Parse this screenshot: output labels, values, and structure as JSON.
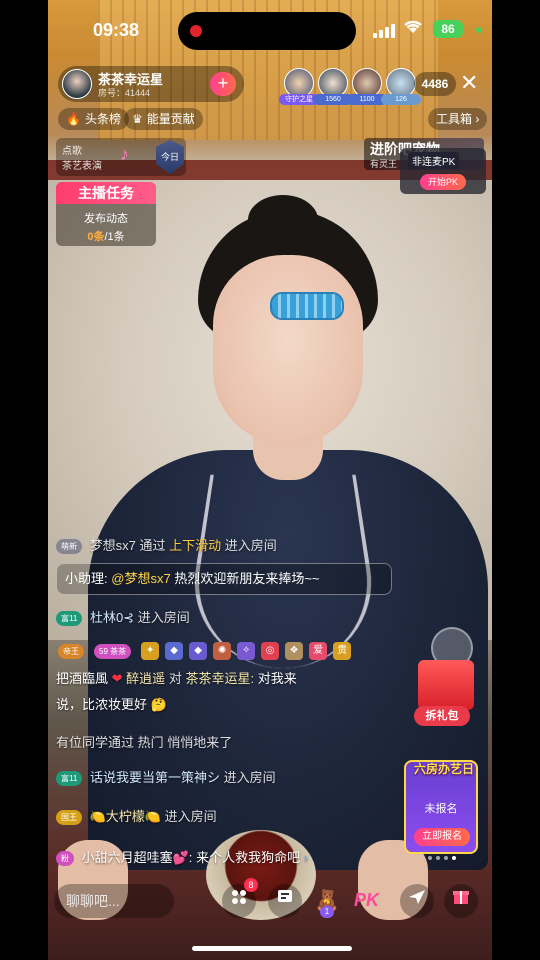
{
  "status_bar": {
    "time": "09:38",
    "battery": "86"
  },
  "host": {
    "name": "茶茶幸运星",
    "room_id": "房号：41444",
    "follow_label": "+"
  },
  "top_viewers": {
    "tags": [
      "守护之星",
      "1560",
      "1100",
      "126"
    ],
    "count": "4486"
  },
  "chips": {
    "headline": "头条榜",
    "energy": "能量贡献",
    "toolbox": "工具箱"
  },
  "song": {
    "line1": "点歌",
    "line2": "茶艺表演",
    "shield_label": "今日"
  },
  "pk": {
    "banner_title": "进阶吧宠物",
    "banner_sub": "有灵王",
    "panel_title": "非连麦PK",
    "start_label": "开始PK"
  },
  "task": {
    "title": "主播任务",
    "line1": "发布动态",
    "progress": "0条",
    "total": "/1条"
  },
  "chat": [
    {
      "badge": "萌新",
      "user": "梦想sx7",
      "text": "通过",
      "highlight": "上下滑动",
      "tail": "进入房间"
    },
    {
      "assistant": "小助理:",
      "mention": "@梦想sx7",
      "text": "热烈欢迎新朋友来捧场~~"
    },
    {
      "badge": "富11",
      "user": "杜林0⊰",
      "text": "进入房间"
    },
    {
      "line_a": "把酒臨風",
      "heart": "❤",
      "from": "醉逍遥",
      "to_word": "对",
      "to": "茶茶幸运星:",
      "msg": "对我来"
    },
    {
      "line_b": "说，比浓妆更好",
      "emoji": "🤔"
    },
    {
      "text": "有位同学通过 热门 悄悄地来了"
    },
    {
      "badge": "富11",
      "user": "话说我要当第一策神シ",
      "text": "进入房间"
    },
    {
      "badge": "国王",
      "user": "🍋大柠檬🍋",
      "text": "进入房间"
    },
    {
      "badge": "粉",
      "user": "小甜六月超哇塞💕:",
      "text": "来个人救我狗命吧"
    }
  ],
  "badge_row": {
    "king": "帝王",
    "level": "59",
    "tea": "茶茶",
    "heart": "爱",
    "gold": "贵"
  },
  "gift": {
    "label": "拆礼包"
  },
  "ad": {
    "title": "六房办艺日",
    "status": "未报名",
    "button": "立即报名"
  },
  "bottom_bar": {
    "placeholder": "聊聊吧...",
    "badge_count": "8",
    "pk": "PK",
    "level": "1"
  }
}
